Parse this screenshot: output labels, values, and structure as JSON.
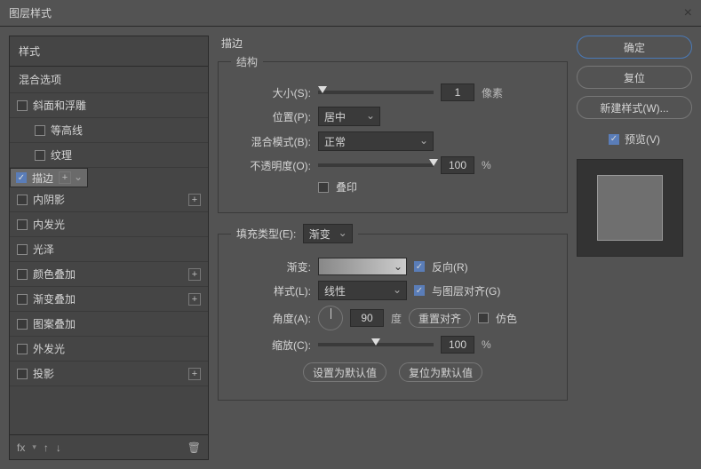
{
  "title": "图层样式",
  "left": {
    "header": "样式",
    "sub": "混合选项",
    "items": [
      {
        "label": "斜面和浮雕",
        "checked": false,
        "plus": false,
        "indent": 0
      },
      {
        "label": "等高线",
        "checked": false,
        "plus": false,
        "indent": 1
      },
      {
        "label": "纹理",
        "checked": false,
        "plus": false,
        "indent": 1
      },
      {
        "label": "描边",
        "checked": true,
        "plus": true,
        "indent": 0,
        "selected": true
      },
      {
        "label": "内阴影",
        "checked": false,
        "plus": true,
        "indent": 0
      },
      {
        "label": "内发光",
        "checked": false,
        "plus": false,
        "indent": 0
      },
      {
        "label": "光泽",
        "checked": false,
        "plus": false,
        "indent": 0
      },
      {
        "label": "颜色叠加",
        "checked": false,
        "plus": true,
        "indent": 0
      },
      {
        "label": "渐变叠加",
        "checked": false,
        "plus": true,
        "indent": 0
      },
      {
        "label": "图案叠加",
        "checked": false,
        "plus": false,
        "indent": 0
      },
      {
        "label": "外发光",
        "checked": false,
        "plus": false,
        "indent": 0
      },
      {
        "label": "投影",
        "checked": false,
        "plus": true,
        "indent": 0
      }
    ],
    "fx": "fx"
  },
  "mid": {
    "groupTitle": "描边",
    "fs1": "结构",
    "size": {
      "label": "大小(S):",
      "value": "1",
      "unit": "像素"
    },
    "position": {
      "label": "位置(P):",
      "value": "居中"
    },
    "blend": {
      "label": "混合模式(B):",
      "value": "正常"
    },
    "opacity": {
      "label": "不透明度(O):",
      "value": "100",
      "unit": "%"
    },
    "overprint": {
      "label": "叠印",
      "checked": false
    },
    "fs2": {
      "label": "填充类型(E):",
      "value": "渐变"
    },
    "gradient": {
      "label": "渐变:"
    },
    "reverse": {
      "label": "反向(R)",
      "checked": true
    },
    "style": {
      "label": "样式(L):",
      "value": "线性"
    },
    "align": {
      "label": "与图层对齐(G)",
      "checked": true
    },
    "angle": {
      "label": "角度(A):",
      "value": "90",
      "unit": "度"
    },
    "resetAlign": "重置对齐",
    "dither": {
      "label": "仿色",
      "checked": false
    },
    "scale": {
      "label": "缩放(C):",
      "value": "100",
      "unit": "%"
    },
    "setDefault": "设置为默认值",
    "resetDefault": "复位为默认值"
  },
  "right": {
    "ok": "确定",
    "cancel": "复位",
    "newStyle": "新建样式(W)...",
    "preview": {
      "label": "预览(V)",
      "checked": true
    }
  }
}
